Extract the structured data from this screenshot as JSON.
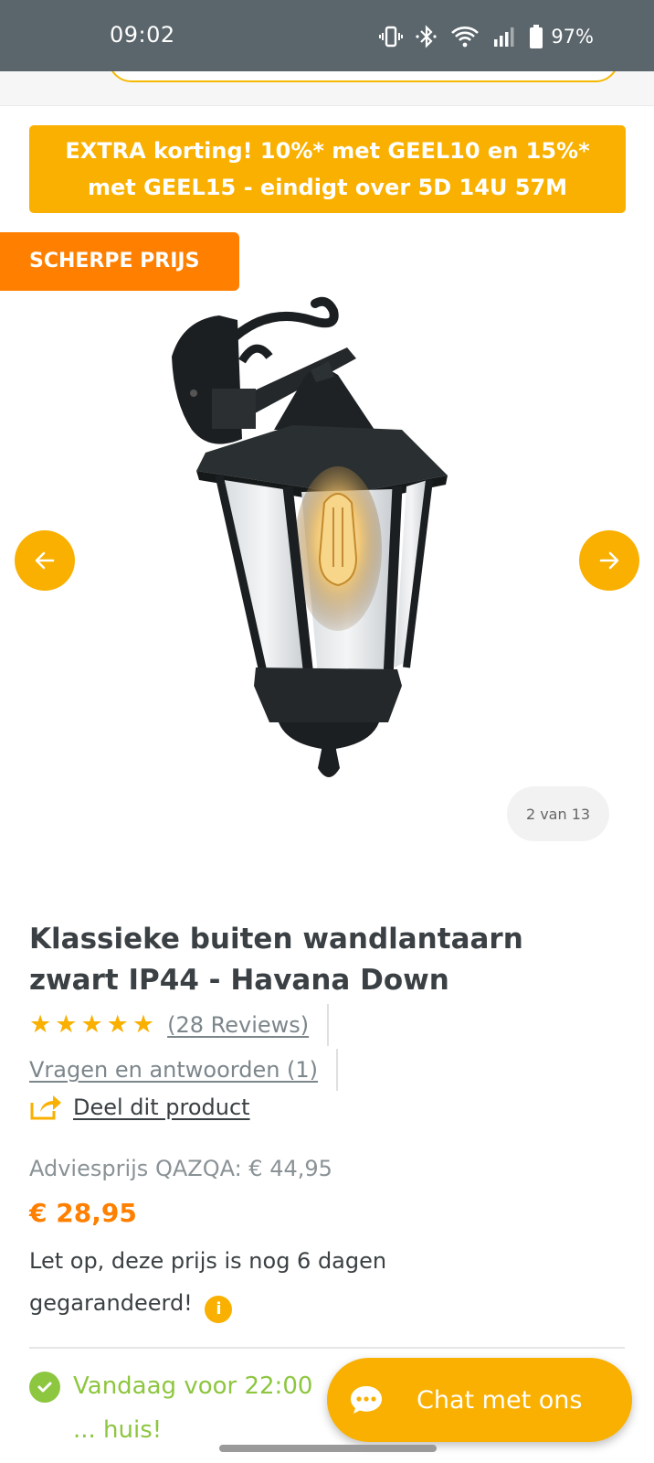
{
  "status_bar": {
    "time": "09:02",
    "battery": "97%",
    "icons": [
      "vibrate-icon",
      "bluetooth-icon",
      "wifi-icon",
      "signal-icon",
      "battery-icon"
    ]
  },
  "promo": {
    "line1": "EXTRA korting! 10%* met GEEL10 en 15%*",
    "line2": "met GEEL15 - eindigt over 5D 14U 57M"
  },
  "badge": "SCHERPE PRIJS",
  "gallery": {
    "counter": "2 van 13"
  },
  "product": {
    "title": "Klassieke buiten wandlantaarn zwart IP44 - Havana Down",
    "rating_stars": 5,
    "reviews_link": "(28 Reviews)",
    "qa_link": "Vragen en antwoorden (1)",
    "share_link": "Deel dit product",
    "advice_price": "Adviesprijs QAZQA:  € 44,95",
    "price": "€ 28,95",
    "guarantee": "Let op, deze prijs is nog 6 dagen gegarandeerd!",
    "delivery": "Vandaag voor 22:00 ... huis!"
  },
  "chat": {
    "label": "Chat met ons"
  },
  "colors": {
    "accent": "#f9b000",
    "orange": "#ff7f00",
    "green": "#8dc63f",
    "statusbar": "#5b666c"
  }
}
